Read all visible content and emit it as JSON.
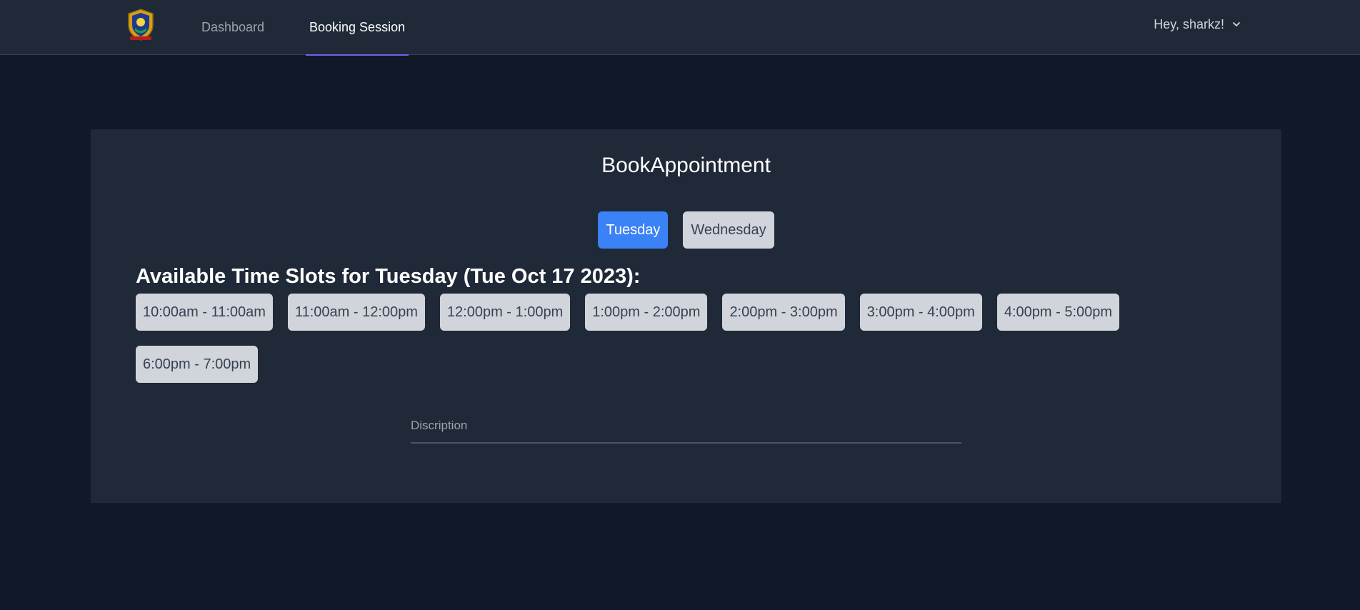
{
  "nav": {
    "links": [
      {
        "label": "Dashboard"
      },
      {
        "label": "Booking Session"
      }
    ],
    "user_label": "Hey, sharkz!"
  },
  "booking": {
    "title": "BookAppointment",
    "days": [
      {
        "label": "Tuesday",
        "selected": true
      },
      {
        "label": "Wednesday",
        "selected": false
      }
    ],
    "slots_heading": "Available Time Slots for Tuesday (Tue Oct 17 2023):",
    "slots": [
      "10:00am - 11:00am",
      "11:00am - 12:00pm",
      "12:00pm - 1:00pm",
      "1:00pm - 2:00pm",
      "2:00pm - 3:00pm",
      "3:00pm - 4:00pm",
      "4:00pm - 5:00pm",
      "6:00pm - 7:00pm"
    ],
    "description_placeholder": "Discription"
  },
  "colors": {
    "page_bg": "#111827",
    "surface": "#1f2937",
    "accent": "#3b82f6",
    "nav_indicator": "#6366f1",
    "button_gray": "#d1d5db"
  },
  "icons": {
    "logo": "crest-logo",
    "user_menu": "chevron-down-icon"
  }
}
